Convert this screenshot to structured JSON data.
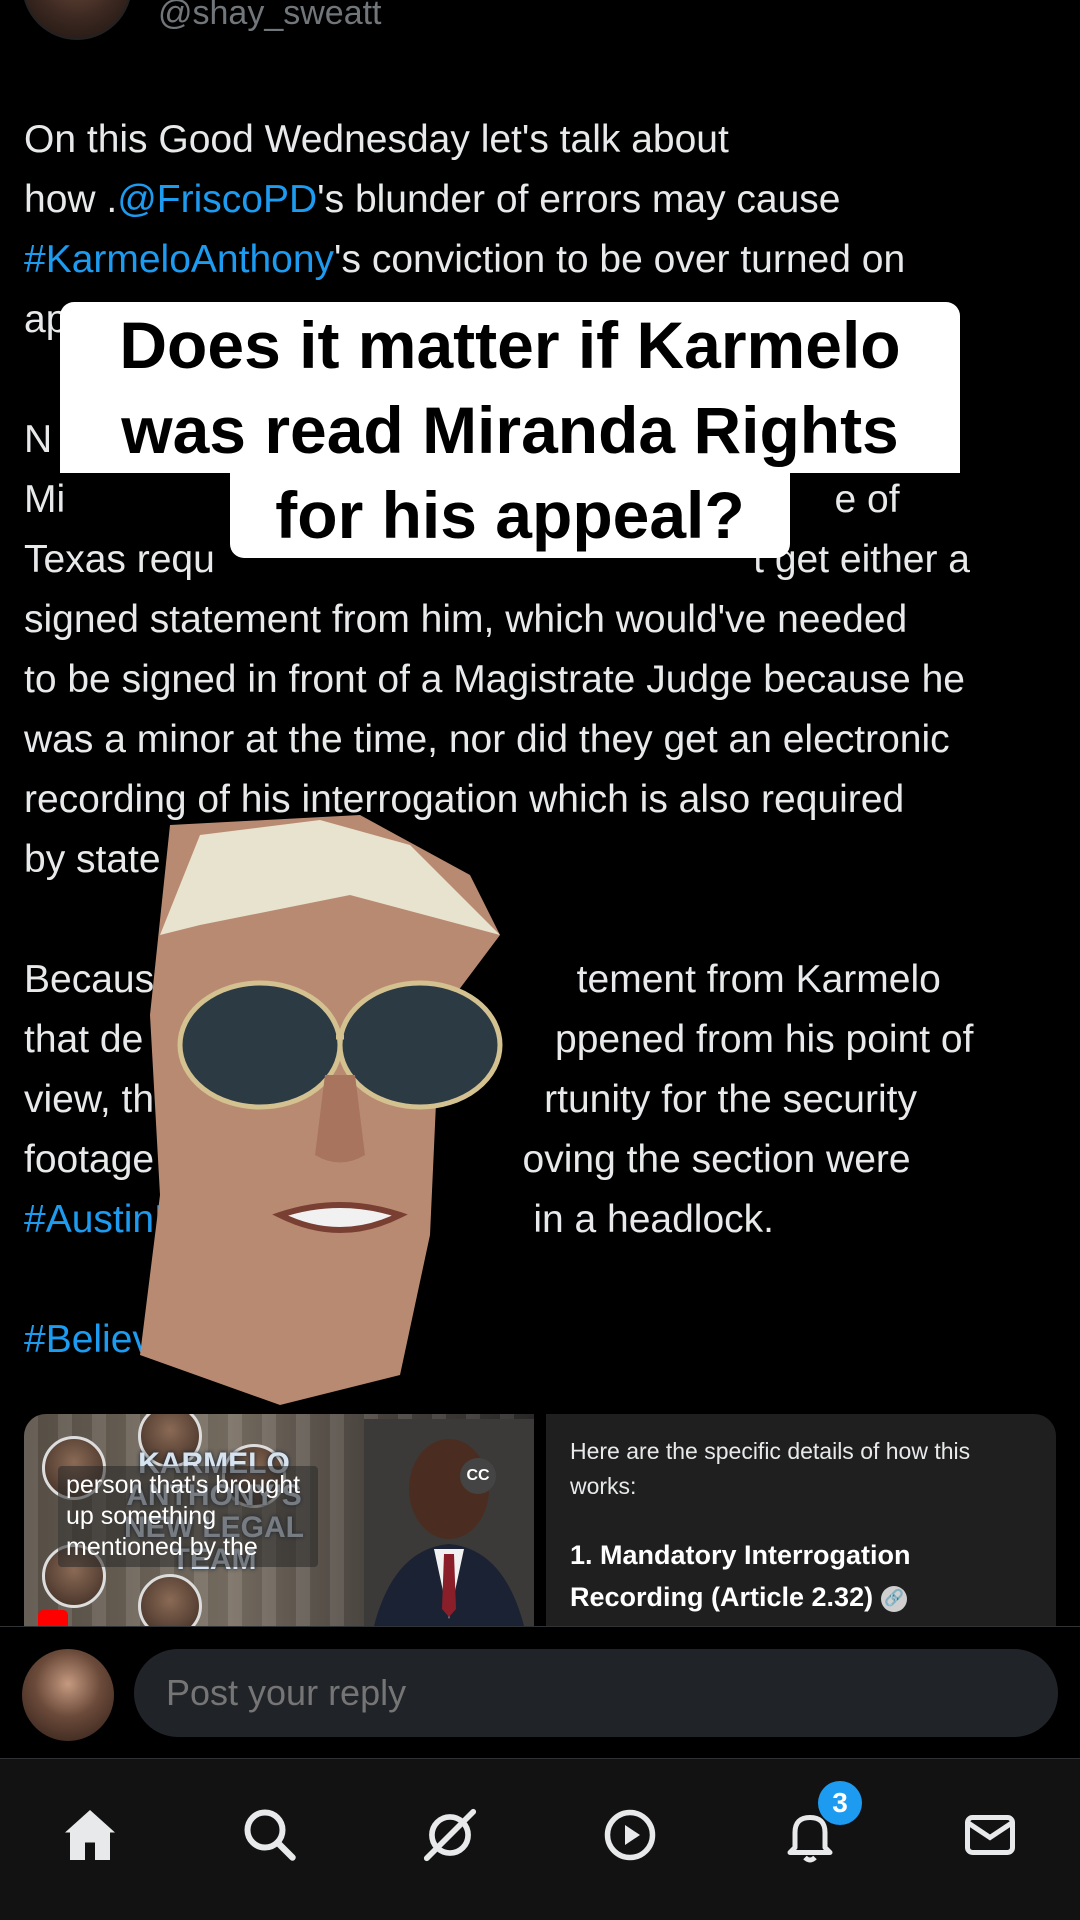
{
  "tweet": {
    "handle": "@shay_sweatt",
    "text_parts": [
      {
        "t": "On this Good Wednesday let's talk about\nhow .",
        "link": false
      },
      {
        "t": "@FriscoPD",
        "link": true
      },
      {
        "t": "'s blunder of errors may cause\n",
        "link": false
      },
      {
        "t": "#KarmeloAnthony",
        "link": true
      },
      {
        "t": "'s conviction to be over turned on\nap",
        "link": false
      },
      {
        "t": "\n\nN",
        "link": false
      },
      {
        "t": "                                                                         his\nMi",
        "link": false
      },
      {
        "t": "                                                                       e of\nTexas requ",
        "link": false
      },
      {
        "t": "                                                 't get either a\nsigned statement from him, which would've needed\nto be signed in front of a Magistrate Judge because he\nwas a minor at the time, nor did they get an electronic\nrecording of his interrogation which is also required\nby state la",
        "link": false
      },
      {
        "t": "\n\nBecaus",
        "link": false
      },
      {
        "t": "                                       tement from Karmelo\nthat de",
        "link": false
      },
      {
        "t": "                                      ppened from his point of\nview, th",
        "link": false
      },
      {
        "t": "                                    rtunity for the security\nfootage",
        "link": false
      },
      {
        "t": "                                  oving the section were\n",
        "link": false
      },
      {
        "t": "#AustinM",
        "link": true
      },
      {
        "t": "                                in a headlock.\n\n",
        "link": false
      },
      {
        "t": "#Believe",
        "link": true
      }
    ]
  },
  "caption": {
    "lines": [
      "Does it matter if Karmelo",
      "was read Miranda Rights",
      "for his appeal?"
    ]
  },
  "video_card": {
    "title": "KARMELO ANTHONY'S NEW LEGAL TEAM",
    "overlay_caption": "person that's brought up something mentioned by the",
    "cc_label": "CC"
  },
  "answer_card": {
    "intro": "Here are the specific details of how this works:",
    "heading": "1. Mandatory Interrogation Recording (Article 2.32)"
  },
  "reply": {
    "placeholder": "Post your reply"
  },
  "nav": {
    "items": [
      "home-icon",
      "search-icon",
      "grok-icon",
      "video-icon",
      "notifications-icon",
      "messages-icon"
    ],
    "notification_count": "3"
  },
  "colors": {
    "link": "#1d9bf0",
    "text": "#e7e9ea",
    "muted": "#71767b",
    "background": "#000000"
  }
}
